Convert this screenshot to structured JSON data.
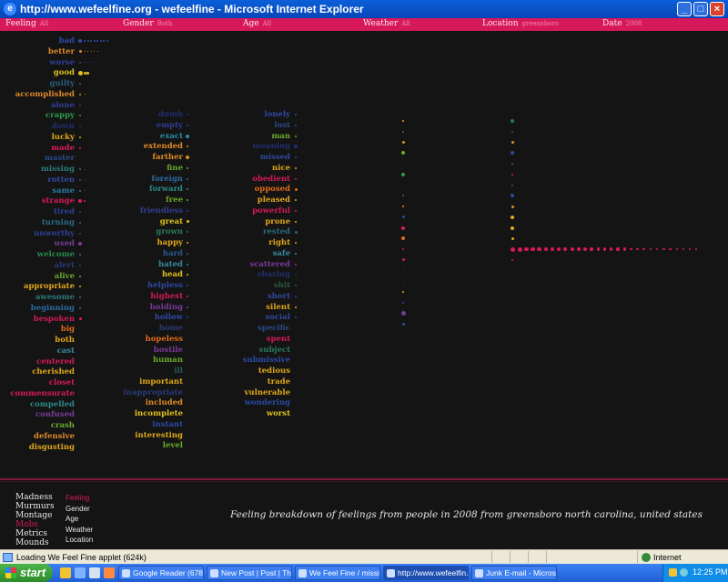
{
  "window": {
    "title": "http://www.wefeelfine.org - wefeelfine - Microsoft Internet Explorer",
    "controls": [
      "_",
      "□",
      "×"
    ]
  },
  "filters": [
    {
      "label": "Feeling",
      "value": "All"
    },
    {
      "label": "Gender",
      "value": "Both"
    },
    {
      "label": "Age",
      "value": "All"
    },
    {
      "label": "Weather",
      "value": "All"
    },
    {
      "label": "Location",
      "value": "greensboro"
    },
    {
      "label": "Date",
      "value": "2008"
    }
  ],
  "colors": {
    "filter_bar": "#d6195a",
    "background": "#141414",
    "divider": "#7b1b3a"
  },
  "columns": [
    {
      "words": [
        {
          "t": "bad",
          "c": "#2f4aa3",
          "n": 9,
          "s": 4
        },
        {
          "t": "better",
          "c": "#e08a26",
          "n": 6,
          "s": 3
        },
        {
          "t": "worse",
          "c": "#2e3f96",
          "n": 5,
          "s": 2
        },
        {
          "t": "good",
          "c": "#e0c21a",
          "n": 3,
          "s": 5
        },
        {
          "t": "guilty",
          "c": "#2a5e7a",
          "n": 1,
          "s": 2
        },
        {
          "t": "accomplished",
          "c": "#e08a26",
          "n": 2,
          "s": 2
        },
        {
          "t": "alone",
          "c": "#2e3f96",
          "n": 1,
          "s": 2
        },
        {
          "t": "crappy",
          "c": "#2a9a4a",
          "n": 1,
          "s": 2
        },
        {
          "t": "down",
          "c": "#1e2f6e",
          "n": 1,
          "s": 2
        },
        {
          "t": "lucky",
          "c": "#e0a71a",
          "n": 1,
          "s": 2
        },
        {
          "t": "made",
          "c": "#d6195a",
          "n": 1,
          "s": 2
        },
        {
          "t": "master",
          "c": "#2a4a8a",
          "n": 0,
          "s": 2
        },
        {
          "t": "missing",
          "c": "#2a7a7a",
          "n": 2,
          "s": 2
        },
        {
          "t": "rotten",
          "c": "#2f4aa3",
          "n": 2,
          "s": 2
        },
        {
          "t": "same",
          "c": "#2a7aa3",
          "n": 2,
          "s": 2
        },
        {
          "t": "strange",
          "c": "#d6195a",
          "n": 2,
          "s": 4
        },
        {
          "t": "tired",
          "c": "#2e3f96",
          "n": 1,
          "s": 2
        },
        {
          "t": "turning",
          "c": "#2a6a8a",
          "n": 1,
          "s": 2
        },
        {
          "t": "unworthy",
          "c": "#2e3f96",
          "n": 1,
          "s": 2
        },
        {
          "t": "used",
          "c": "#7a3a9a",
          "n": 1,
          "s": 4
        },
        {
          "t": "welcome",
          "c": "#2a8a4a",
          "n": 1,
          "s": 2
        },
        {
          "t": "alert",
          "c": "#2a3a7a",
          "n": 1,
          "s": 2
        },
        {
          "t": "alive",
          "c": "#6aaa2a",
          "n": 1,
          "s": 2
        },
        {
          "t": "appropriate",
          "c": "#e0a71a",
          "n": 1,
          "s": 2
        },
        {
          "t": "awesome",
          "c": "#2a7a7a",
          "n": 1,
          "s": 2
        },
        {
          "t": "beginning",
          "c": "#2a6aa3",
          "n": 1,
          "s": 2
        },
        {
          "t": "bespoken",
          "c": "#d6195a",
          "n": 1,
          "s": 3
        },
        {
          "t": "big",
          "c": "#e06a1a",
          "n": 0,
          "s": 2
        },
        {
          "t": "both",
          "c": "#e0a71a",
          "n": 0,
          "s": 2
        },
        {
          "t": "cast",
          "c": "#3a8aa3",
          "n": 0,
          "s": 2
        },
        {
          "t": "centered",
          "c": "#d6195a",
          "n": 0,
          "s": 2
        },
        {
          "t": "cherished",
          "c": "#e0a71a",
          "n": 0,
          "s": 2
        },
        {
          "t": "closet",
          "c": "#d6195a",
          "n": 0,
          "s": 2
        },
        {
          "t": "commensurate",
          "c": "#d6195a",
          "n": 0,
          "s": 2
        },
        {
          "t": "compelled",
          "c": "#2a8a8a",
          "n": 0,
          "s": 2
        },
        {
          "t": "confused",
          "c": "#7a3a9a",
          "n": 0,
          "s": 2
        },
        {
          "t": "crash",
          "c": "#6aaa2a",
          "n": 0,
          "s": 2
        },
        {
          "t": "defensive",
          "c": "#e08a26",
          "n": 0,
          "s": 2
        },
        {
          "t": "disgusting",
          "c": "#e0a71a",
          "n": 0,
          "s": 2
        }
      ]
    },
    {
      "words": [
        {
          "t": "dumb",
          "c": "#1e2f6e",
          "n": 1,
          "s": 2
        },
        {
          "t": "empty",
          "c": "#2e3f96",
          "n": 1,
          "s": 2
        },
        {
          "t": "exact",
          "c": "#2a8aa3",
          "n": 1,
          "s": 4
        },
        {
          "t": "extended",
          "c": "#e08a26",
          "n": 1,
          "s": 2
        },
        {
          "t": "farther",
          "c": "#e08a26",
          "n": 1,
          "s": 4
        },
        {
          "t": "fine",
          "c": "#6aaa2a",
          "n": 1,
          "s": 2
        },
        {
          "t": "foreign",
          "c": "#2a6aa3",
          "n": 1,
          "s": 2
        },
        {
          "t": "forward",
          "c": "#2a8a8a",
          "n": 1,
          "s": 2
        },
        {
          "t": "free",
          "c": "#6aaa2a",
          "n": 1,
          "s": 2
        },
        {
          "t": "friendless",
          "c": "#2e3f96",
          "n": 1,
          "s": 2
        },
        {
          "t": "great",
          "c": "#e0c21a",
          "n": 1,
          "s": 3
        },
        {
          "t": "grown",
          "c": "#2a7a5a",
          "n": 1,
          "s": 2
        },
        {
          "t": "happy",
          "c": "#e0a71a",
          "n": 1,
          "s": 2
        },
        {
          "t": "hard",
          "c": "#2a5a8a",
          "n": 1,
          "s": 2
        },
        {
          "t": "hated",
          "c": "#3a8aa3",
          "n": 1,
          "s": 2
        },
        {
          "t": "head",
          "c": "#e0c21a",
          "n": 1,
          "s": 2
        },
        {
          "t": "helpless",
          "c": "#2e4aa3",
          "n": 1,
          "s": 2
        },
        {
          "t": "highest",
          "c": "#d6195a",
          "n": 1,
          "s": 2
        },
        {
          "t": "holding",
          "c": "#7a3a9a",
          "n": 1,
          "s": 2
        },
        {
          "t": "hollow",
          "c": "#2e4aa3",
          "n": 1,
          "s": 2
        },
        {
          "t": "home",
          "c": "#2a3a7a",
          "n": 0,
          "s": 2
        },
        {
          "t": "hopeless",
          "c": "#e06a1a",
          "n": 0,
          "s": 2
        },
        {
          "t": "hostile",
          "c": "#7a3a9a",
          "n": 0,
          "s": 2
        },
        {
          "t": "human",
          "c": "#6aaa2a",
          "n": 0,
          "s": 2
        },
        {
          "t": "ill",
          "c": "#2a5a5a",
          "n": 0,
          "s": 2
        },
        {
          "t": "important",
          "c": "#e0a71a",
          "n": 0,
          "s": 2
        },
        {
          "t": "inappropriate",
          "c": "#2a3a7a",
          "n": 0,
          "s": 2
        },
        {
          "t": "included",
          "c": "#e08a26",
          "n": 0,
          "s": 2
        },
        {
          "t": "incomplete",
          "c": "#e0c21a",
          "n": 0,
          "s": 2
        },
        {
          "t": "instant",
          "c": "#2a4aa3",
          "n": 0,
          "s": 2
        },
        {
          "t": "interesting",
          "c": "#e0a71a",
          "n": 0,
          "s": 2
        },
        {
          "t": "level",
          "c": "#6aaa2a",
          "n": 0,
          "s": 2
        }
      ]
    },
    {
      "words": [
        {
          "t": "lonely",
          "c": "#2e4aa3",
          "n": 1,
          "s": 2
        },
        {
          "t": "lost",
          "c": "#2a4a8a",
          "n": 1,
          "s": 2
        },
        {
          "t": "man",
          "c": "#6aaa2a",
          "n": 1,
          "s": 2
        },
        {
          "t": "meaning",
          "c": "#1e2f6e",
          "n": 1,
          "s": 4
        },
        {
          "t": "missed",
          "c": "#2e4aa3",
          "n": 1,
          "s": 2
        },
        {
          "t": "nice",
          "c": "#e0a71a",
          "n": 1,
          "s": 2
        },
        {
          "t": "obedient",
          "c": "#d6195a",
          "n": 1,
          "s": 2
        },
        {
          "t": "opposed",
          "c": "#e06a1a",
          "n": 1,
          "s": 3
        },
        {
          "t": "pleased",
          "c": "#e0a71a",
          "n": 1,
          "s": 2
        },
        {
          "t": "powerful",
          "c": "#d6195a",
          "n": 1,
          "s": 2
        },
        {
          "t": "prone",
          "c": "#e0a71a",
          "n": 1,
          "s": 2
        },
        {
          "t": "rested",
          "c": "#2a6a7a",
          "n": 1,
          "s": 3
        },
        {
          "t": "right",
          "c": "#e0a71a",
          "n": 1,
          "s": 2
        },
        {
          "t": "safe",
          "c": "#3a8aa3",
          "n": 1,
          "s": 2
        },
        {
          "t": "scattered",
          "c": "#7a3a9a",
          "n": 1,
          "s": 2
        },
        {
          "t": "sharing",
          "c": "#1e2f6e",
          "n": 1,
          "s": 2
        },
        {
          "t": "shit",
          "c": "#2a5a3a",
          "n": 1,
          "s": 2
        },
        {
          "t": "short",
          "c": "#2e4aa3",
          "n": 1,
          "s": 2
        },
        {
          "t": "silent",
          "c": "#e0a71a",
          "n": 1,
          "s": 2
        },
        {
          "t": "social",
          "c": "#2e4aa3",
          "n": 1,
          "s": 2
        },
        {
          "t": "specific",
          "c": "#2a4a8a",
          "n": 0,
          "s": 2
        },
        {
          "t": "spent",
          "c": "#d6195a",
          "n": 0,
          "s": 2
        },
        {
          "t": "subject",
          "c": "#2a7a5a",
          "n": 0,
          "s": 2
        },
        {
          "t": "submissive",
          "c": "#2a4aa3",
          "n": 0,
          "s": 2
        },
        {
          "t": "tedious",
          "c": "#e0a71a",
          "n": 0,
          "s": 2
        },
        {
          "t": "trade",
          "c": "#e0a71a",
          "n": 0,
          "s": 2
        },
        {
          "t": "vulnerable",
          "c": "#e0a71a",
          "n": 0,
          "s": 2
        },
        {
          "t": "wondering",
          "c": "#2a4aa3",
          "n": 0,
          "s": 2
        },
        {
          "t": "worst",
          "c": "#e0c21a",
          "n": 0,
          "s": 2
        }
      ]
    }
  ],
  "weather_dots": [
    {
      "c": "#e0a71a",
      "s": 2
    },
    {
      "c": "#2a6aa3",
      "s": 2
    },
    {
      "c": "#e08a26",
      "s": 3
    },
    {
      "c": "#6aaa2a",
      "s": 4
    },
    {
      "c": "#2a3a7a",
      "s": 1
    },
    {
      "c": "#2a9a4a",
      "s": 4
    },
    {
      "c": "#2a3a7a",
      "s": 1
    },
    {
      "c": "#2a6aa3",
      "s": 2
    },
    {
      "c": "#e08a26",
      "s": 2
    },
    {
      "c": "#2e4aa3",
      "s": 3
    },
    {
      "c": "#d6195a",
      "s": 4
    },
    {
      "c": "#e06a1a",
      "s": 4
    },
    {
      "c": "#d6195a",
      "s": 2
    },
    {
      "c": "#d6195a",
      "s": 3
    },
    {
      "c": "#2a3a7a",
      "s": 1
    },
    {
      "c": "#2a3a7a",
      "s": 1
    },
    {
      "c": "#e0a71a",
      "s": 2
    },
    {
      "c": "#2e4aa3",
      "s": 2
    },
    {
      "c": "#7a3a9a",
      "s": 5
    },
    {
      "c": "#2e4aa3",
      "s": 3
    }
  ],
  "location_dots": [
    {
      "c": "#2a7a5a",
      "s": 4
    },
    {
      "c": "#2a4aa3",
      "s": 2
    },
    {
      "c": "#e08a26",
      "s": 3
    },
    {
      "c": "#2e4aa3",
      "s": 4
    },
    {
      "c": "#2a6aa3",
      "s": 2
    },
    {
      "c": "#d6195a",
      "s": 2
    },
    {
      "c": "#2a5a8a",
      "s": 2
    },
    {
      "c": "#2e4aa3",
      "s": 4
    },
    {
      "c": "#e08a26",
      "s": 3
    },
    {
      "c": "#e0a71a",
      "s": 4
    },
    {
      "c": "#e0a71a",
      "s": 4
    },
    {
      "c": "#e0a71a",
      "s": 3
    },
    {
      "c": "#d6195a",
      "s": 5
    },
    {
      "c": "#d6195a",
      "s": 2
    }
  ],
  "location_trail_count": 28,
  "view_modes": [
    {
      "label": "Madness",
      "color": "#e6e6e6"
    },
    {
      "label": "Murmurs",
      "color": "#e6e6e6"
    },
    {
      "label": "Montage",
      "color": "#e6e6e6"
    },
    {
      "label": "Mobs",
      "color": "#d6195a"
    },
    {
      "label": "Metrics",
      "color": "#e6e6e6"
    },
    {
      "label": "Mounds",
      "color": "#e6e6e6"
    }
  ],
  "breakdowns": [
    {
      "label": "Feeling",
      "color": "#d6195a"
    },
    {
      "label": "Gender",
      "color": "#e6e6e6"
    },
    {
      "label": "Age",
      "color": "#e6e6e6"
    },
    {
      "label": "Weather",
      "color": "#e6e6e6"
    },
    {
      "label": "Location",
      "color": "#e6e6e6"
    }
  ],
  "caption": "Feeling breakdown of feelings from people in 2008 from greensboro north carolina, united states",
  "status": {
    "text": "Loading We Feel Fine applet (624k)",
    "zone": "Internet"
  },
  "taskbar": {
    "start": "start",
    "tasks": [
      "Google Reader (678) ...",
      "New Post | Post | The...",
      "We Feel Fine / missio...",
      "http://www.wefeelfin...",
      "Junk E-mail - Microsof..."
    ],
    "active_task": 3,
    "clock": "12:25 PM"
  }
}
